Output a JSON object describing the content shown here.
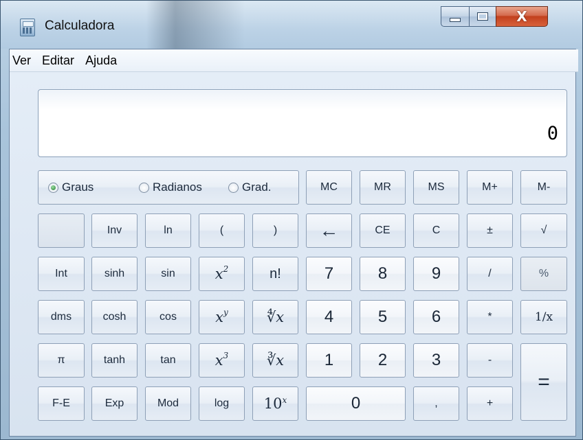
{
  "window": {
    "title": "Calculadora",
    "close_glyph": "X"
  },
  "menu": [
    "Ver",
    "Editar",
    "Ajuda"
  ],
  "display": {
    "value": "0"
  },
  "angle_units": {
    "options": [
      "Graus",
      "Radianos",
      "Grad."
    ],
    "selected": "Graus"
  },
  "memory": [
    "MC",
    "MR",
    "MS",
    "M+",
    "M-"
  ],
  "row2": [
    "",
    "Inv",
    "ln",
    "(",
    ")",
    "←",
    "CE",
    "C",
    "±",
    "√"
  ],
  "row3": [
    "Int",
    "sinh",
    "sin",
    "x",
    "n!",
    "7",
    "8",
    "9",
    "/",
    "%"
  ],
  "row3_sup": "2",
  "row4": [
    "dms",
    "cosh",
    "cos",
    "x",
    "x",
    "4",
    "5",
    "6",
    "*",
    "1/x"
  ],
  "row4_sup": "y",
  "row4_root": "∜",
  "row5": [
    "π",
    "tanh",
    "tan",
    "x",
    "x",
    "1",
    "2",
    "3",
    "-",
    "="
  ],
  "row5_sup": "3",
  "row5_root": "∛",
  "row6": [
    "F-E",
    "Exp",
    "Mod",
    "log",
    "10",
    "0",
    ",",
    "+"
  ],
  "row6_sup": "x",
  "icons": {
    "app": "calculator-icon",
    "minimize": "minimize-icon",
    "maximize": "maximize-icon",
    "close": "close-icon"
  },
  "colors": {
    "close_button": "#c7421f",
    "title_bar": "#bcd2e6",
    "client_bg": "#dde6f1",
    "radio_selected": "#1e7a2e"
  }
}
